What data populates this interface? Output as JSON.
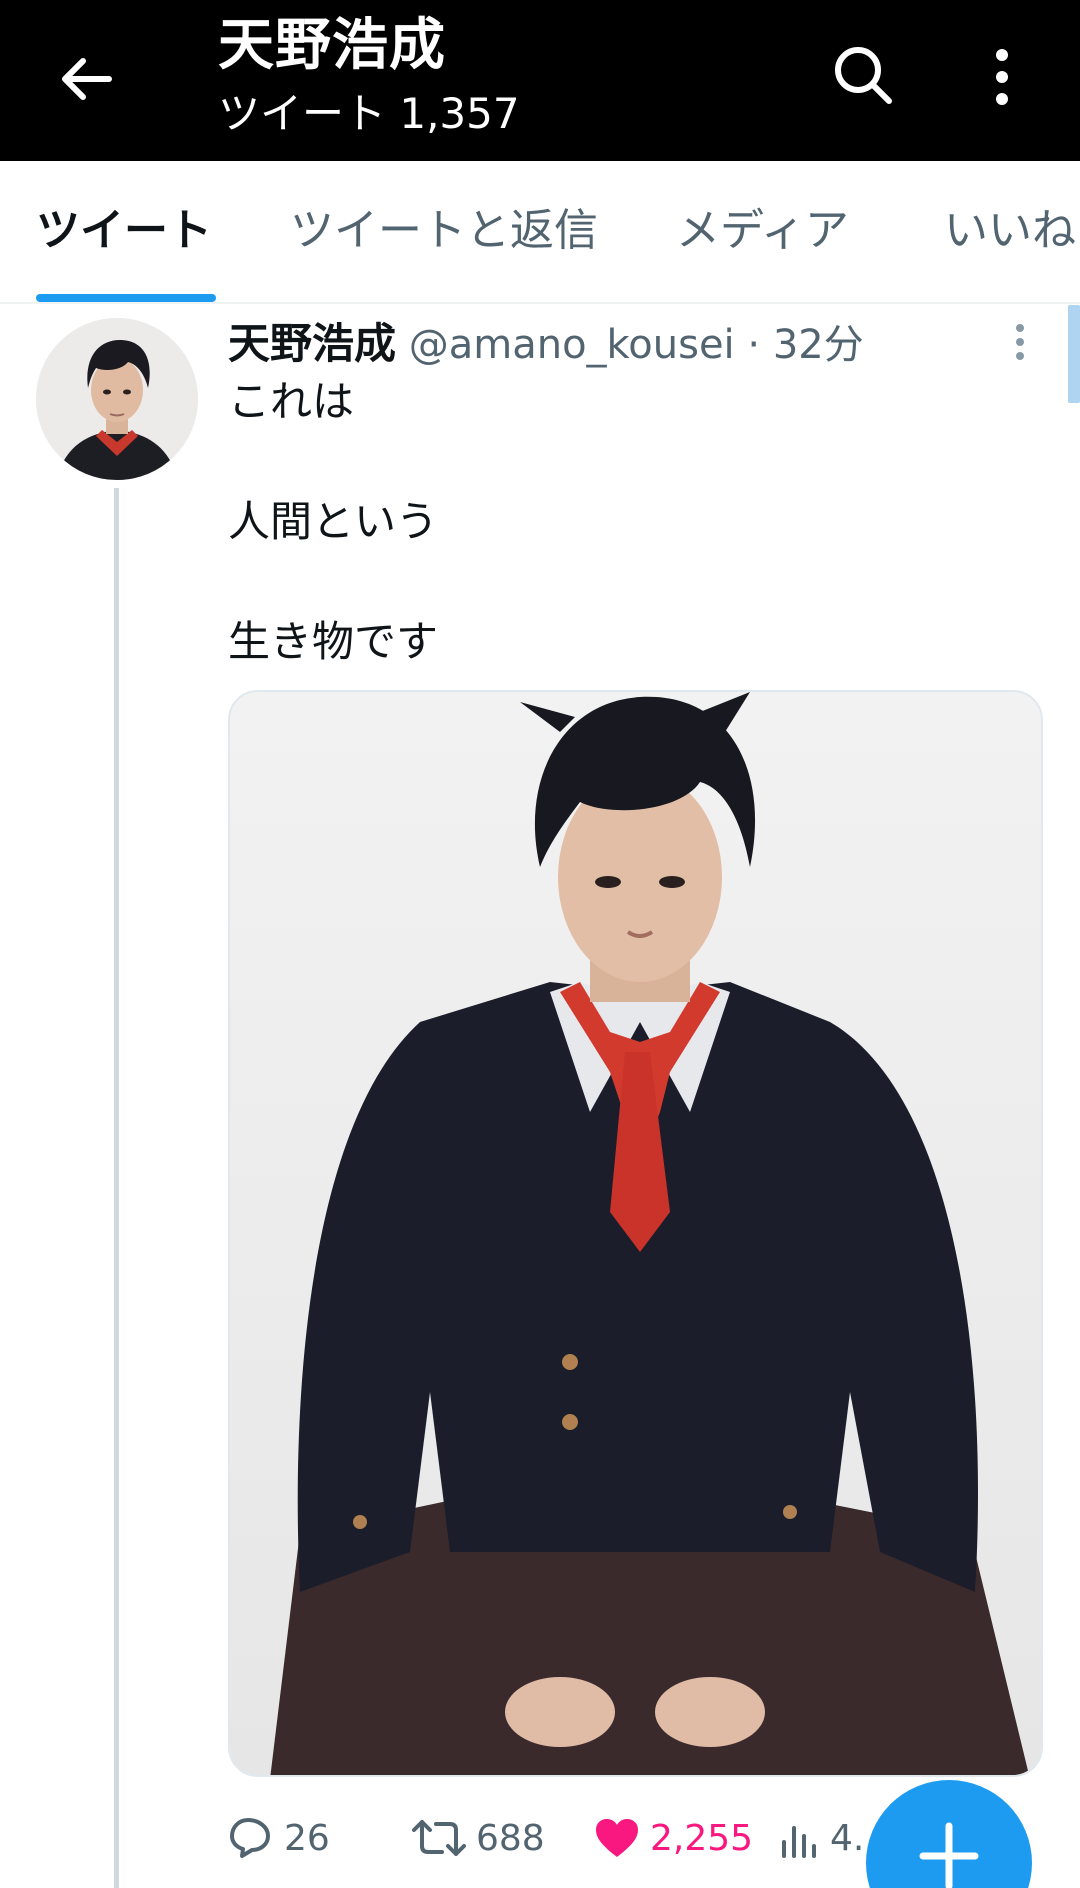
{
  "header": {
    "title": "天野浩成",
    "subtitle": "ツイート 1,357",
    "back_icon": "arrow-left-icon",
    "search_icon": "search-icon",
    "more_icon": "more-vertical-icon"
  },
  "tabs": [
    {
      "label": "ツイート",
      "active": true
    },
    {
      "label": "ツイートと返信",
      "active": false
    },
    {
      "label": "メディア",
      "active": false
    },
    {
      "label": "いいね",
      "active": false
    }
  ],
  "tweet": {
    "name": "天野浩成",
    "handle": "@amano_kousei",
    "separator": "·",
    "time": "32分",
    "lines": [
      "これは",
      "人間という",
      "生き物です"
    ],
    "actions": {
      "reply_count": "26",
      "retweet_count": "688",
      "like_count": "2,255",
      "views_count": "4."
    }
  },
  "colors": {
    "accent": "#1d9bf0",
    "like": "#f91880",
    "muted": "#536471",
    "header_bg": "#000000"
  },
  "fab": {
    "icon": "plus-icon"
  }
}
